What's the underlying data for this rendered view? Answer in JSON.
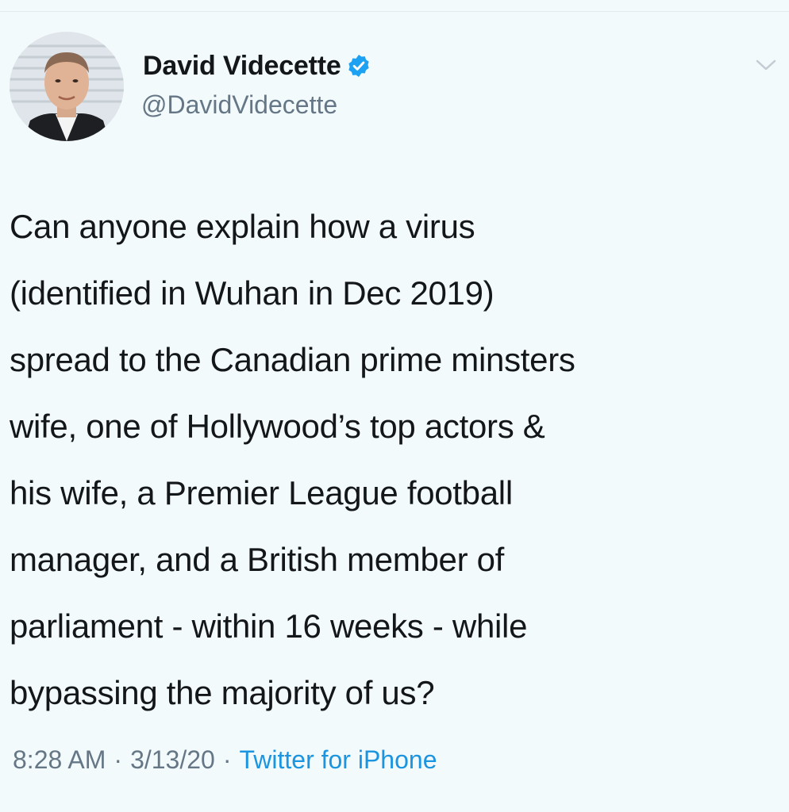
{
  "tweet": {
    "author_name": "David Videcette",
    "author_handle": "@DavidVidecette",
    "verified": true,
    "lines": [
      "Can anyone explain how a virus",
      "(identified in Wuhan in Dec 2019)",
      "spread to the Canadian prime minsters",
      "wife, one of Hollywood’s top actors &",
      "his wife, a Premier League football",
      "manager, and a British member of",
      "parliament - within 16 weeks - while",
      "bypassing the majority of us?"
    ],
    "time": "8:28 AM",
    "separator": "·",
    "date": "3/13/20",
    "source": "Twitter for iPhone"
  },
  "colors": {
    "background": "#f3fafc",
    "text": "#14171a",
    "secondary": "#657786",
    "accent": "#1b95e0",
    "verified": "#1da1f2"
  },
  "icons": {
    "verified": "verified-badge-icon",
    "menu": "chevron-down-icon"
  }
}
